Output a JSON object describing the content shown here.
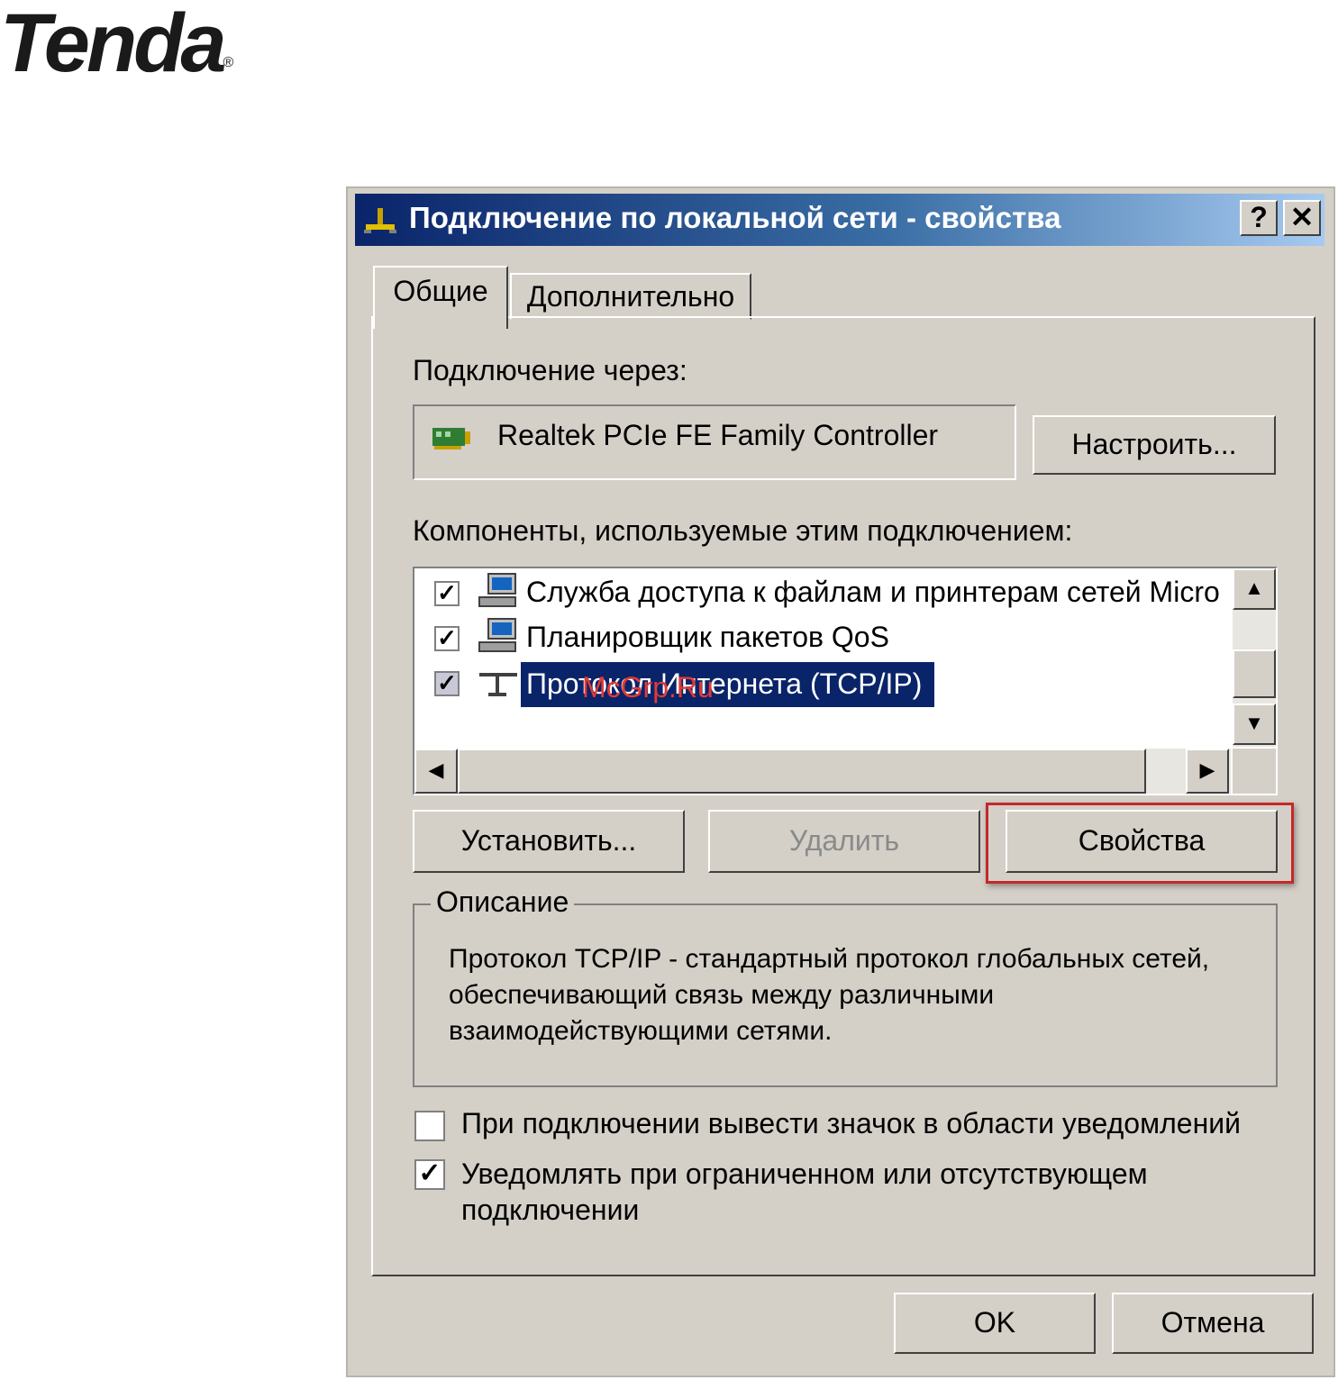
{
  "logo": {
    "text": "Tenda",
    "mark": "®"
  },
  "window": {
    "title": "Подключение по локальной сети - свойства",
    "help_label": "?",
    "close_label": "✕"
  },
  "tabs": [
    {
      "label": "Общие",
      "active": true
    },
    {
      "label": "Дополнительно",
      "active": false
    }
  ],
  "connect_via": {
    "label": "Подключение через:",
    "adapter": "Realtek PCIe FE Family Controller",
    "configure_label": "Настроить..."
  },
  "components": {
    "label": "Компоненты, используемые этим подключением:",
    "items": [
      {
        "label": "Служба доступа к файлам и принтерам сетей Micro",
        "checked": true,
        "icon": "network-service-icon"
      },
      {
        "label": "Планировщик пакетов QoS",
        "checked": true,
        "icon": "network-service-icon"
      },
      {
        "label": "Протокол Интернета (TCP/IP)",
        "checked": true,
        "icon": "protocol-icon",
        "selected": true
      }
    ],
    "watermark": "McGrp.Ru"
  },
  "buttons": {
    "install": "Установить...",
    "remove": "Удалить",
    "properties": "Свойства"
  },
  "description": {
    "title": "Описание",
    "text": "Протокол TCP/IP - стандартный протокол глобальных сетей, обеспечивающий связь между различными взаимодействующими сетями."
  },
  "options": [
    {
      "label": "При подключении вывести значок в области уведомлений",
      "checked": false
    },
    {
      "label": "Уведомлять при ограниченном или отсутствующем подключении",
      "checked": true
    }
  ],
  "footer": {
    "ok": "OK",
    "cancel": "Отмена"
  },
  "colors": {
    "selection": "#0a246a",
    "highlight_frame": "#c62828",
    "watermark": "#e53935"
  }
}
